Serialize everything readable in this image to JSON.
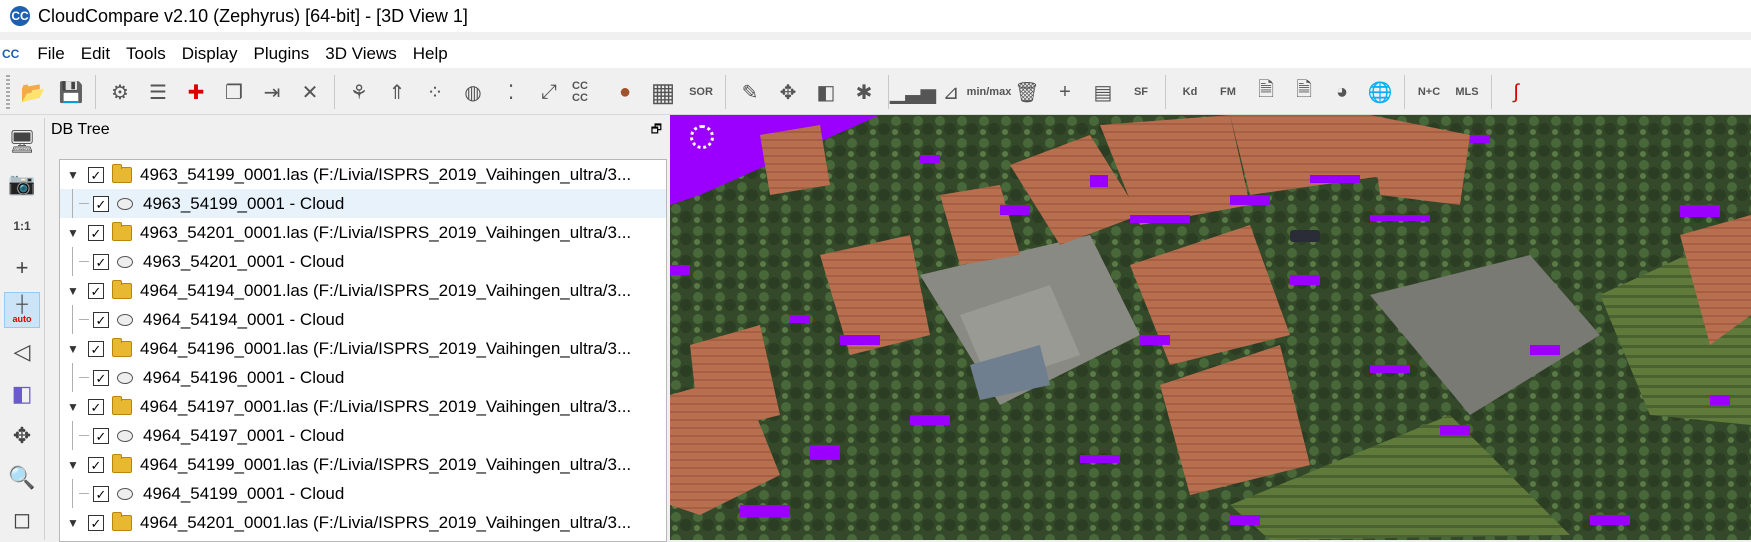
{
  "window": {
    "title": "CloudCompare v2.10 (Zephyrus) [64-bit] - [3D View 1]",
    "logo": "CC"
  },
  "menu": {
    "logo": "CC",
    "items": [
      "File",
      "Edit",
      "Tools",
      "Display",
      "Plugins",
      "3D Views",
      "Help"
    ]
  },
  "toolbar": {
    "sor": "SOR",
    "sf": "SF",
    "kd": "Kd",
    "fm": "FM",
    "nc": "N+C",
    "mls": "MLS",
    "min": "min",
    "max": "max",
    "ccc": "CC CC"
  },
  "left_toolbar": {
    "one_to_one": "1:1",
    "auto": "auto"
  },
  "db_tree": {
    "title": "DB Tree",
    "rows": [
      {
        "label": "4963_54199_0001.las (F:/Livia/ISPRS_2019_Vaihingen_ultra/3...",
        "kind": "file"
      },
      {
        "label": "4963_54199_0001 - Cloud",
        "kind": "cloud"
      },
      {
        "label": "4963_54201_0001.las (F:/Livia/ISPRS_2019_Vaihingen_ultra/3...",
        "kind": "file"
      },
      {
        "label": "4963_54201_0001 - Cloud",
        "kind": "cloud"
      },
      {
        "label": "4964_54194_0001.las (F:/Livia/ISPRS_2019_Vaihingen_ultra/3...",
        "kind": "file"
      },
      {
        "label": "4964_54194_0001 - Cloud",
        "kind": "cloud"
      },
      {
        "label": "4964_54196_0001.las (F:/Livia/ISPRS_2019_Vaihingen_ultra/3...",
        "kind": "file"
      },
      {
        "label": "4964_54196_0001 - Cloud",
        "kind": "cloud"
      },
      {
        "label": "4964_54197_0001.las (F:/Livia/ISPRS_2019_Vaihingen_ultra/3...",
        "kind": "file"
      },
      {
        "label": "4964_54197_0001 - Cloud",
        "kind": "cloud"
      },
      {
        "label": "4964_54199_0001.las (F:/Livia/ISPRS_2019_Vaihingen_ultra/3...",
        "kind": "file"
      },
      {
        "label": "4964_54199_0001 - Cloud",
        "kind": "cloud"
      },
      {
        "label": "4964_54201_0001.las (F:/Livia/ISPRS_2019_Vaihingen_ultra/3...",
        "kind": "file"
      }
    ]
  },
  "colors": {
    "highlight": "#9b00ff",
    "roof": "#b86f4f",
    "vegetation": "#3b5a2c",
    "road": "#808080"
  }
}
